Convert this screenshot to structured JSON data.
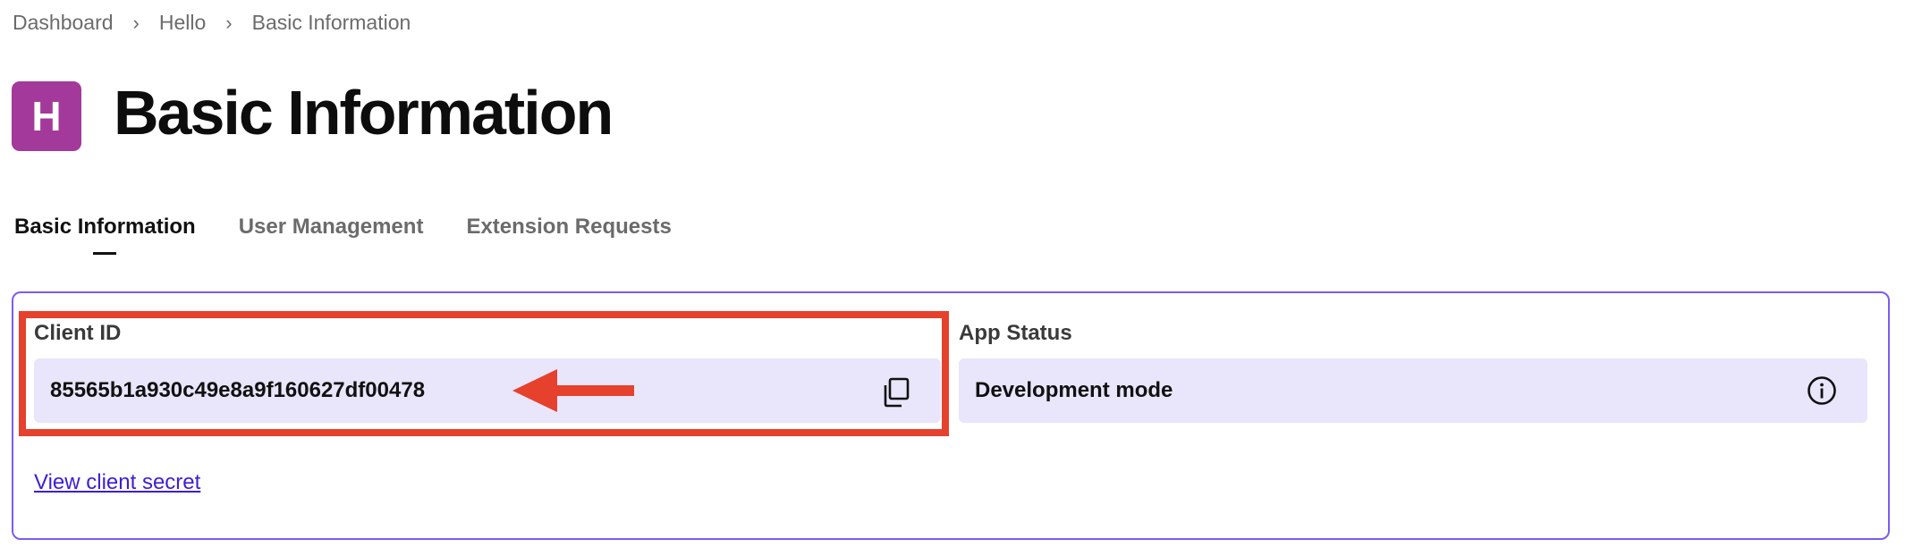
{
  "breadcrumb": {
    "items": [
      "Dashboard",
      "Hello",
      "Basic Information"
    ],
    "separator": "›"
  },
  "header": {
    "avatar_letter": "H",
    "avatar_color": "#a3399a",
    "title": "Basic Information"
  },
  "tabs": [
    {
      "label": "Basic Information",
      "active": true
    },
    {
      "label": "User Management",
      "active": false
    },
    {
      "label": "Extension Requests",
      "active": false
    }
  ],
  "card": {
    "client_id": {
      "label": "Client ID",
      "value": "85565b1a930c49e8a9f160627df00478",
      "icon": "copy-icon"
    },
    "app_status": {
      "label": "App Status",
      "value": "Development mode",
      "icon": "info-icon"
    },
    "view_secret_link": "View client secret"
  },
  "colors": {
    "accent_border": "#7b5cf0",
    "field_background": "#e9e5fb",
    "link": "#3b1fd6",
    "annotation_red": "#e5412d"
  },
  "annotation": {
    "highlight_target": "client-id",
    "arrow_icon": "left-arrow-icon"
  }
}
